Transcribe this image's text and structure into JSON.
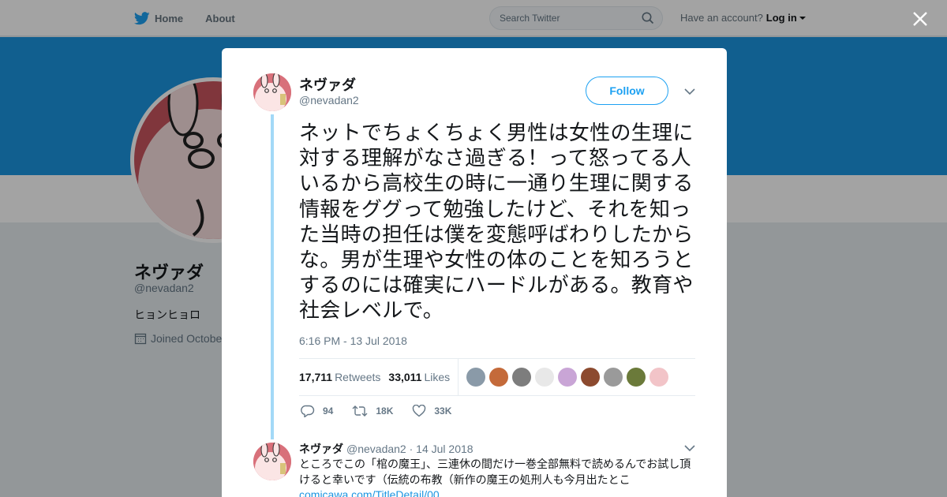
{
  "nav": {
    "home_label": "Home",
    "about_label": "About",
    "search_placeholder": "Search Twitter",
    "account_prompt": "Have an account?",
    "login_label": "Log in"
  },
  "profile": {
    "name": "ネヴァダ",
    "handle": "@nevadan2",
    "bio": "ヒョンヒョロ",
    "joined": "Joined Octobe"
  },
  "colors": {
    "brand": "#1da1f2",
    "banner": "#1b95e0",
    "thread_line": "#a3d9f7",
    "link": "#1b95e0"
  },
  "tweet": {
    "name": "ネヴァダ",
    "handle": "@nevadan2",
    "follow_label": "Follow",
    "text": "ネットでちょくちょく男性は女性の生理に対する理解がなさ過ぎる！って怒ってる人いるから高校生の時に一通り生理に関する情報をググって勉強したけど、それを知った当時の担任は僕を変態呼ばわりしたからな。男が生理や女性の体のことを知ろうとするのには確実にハードルがある。教育や社会レベルで。",
    "timestamp": "6:16 PM - 13 Jul 2018",
    "retweets_count": "17,711",
    "retweets_label": "Retweets",
    "likes_count": "33,011",
    "likes_label": "Likes",
    "reply_count": "94",
    "retweet_count_short": "18K",
    "like_count_short": "33K",
    "likers": [
      "#8a9aa8",
      "#c46a3a",
      "#7d7d7d",
      "#e8e8e8",
      "#c9a5d6",
      "#8c4a2f",
      "#9a9a9a",
      "#6b7a3a",
      "#f2c4c8"
    ]
  },
  "reply": {
    "name": "ネヴァダ",
    "handle": "@nevadan2",
    "date": "· 14 Jul 2018",
    "text": "ところでこの「棺の魔王」、三連休の間だけ一巻全部無料で読めるんでお試し頂けると幸いです（伝統の布教（新作の魔王の処刑人も今月出たとこ",
    "link": "comicawa.com/TitleDetail/00"
  }
}
